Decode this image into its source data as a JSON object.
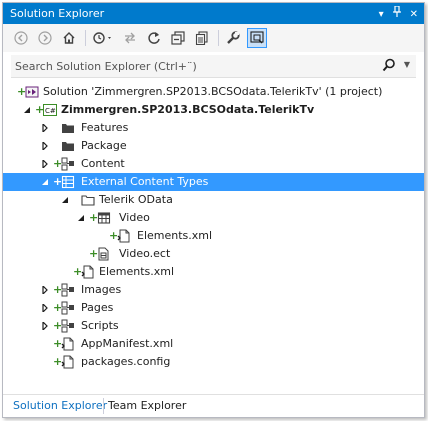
{
  "window": {
    "title": "Solution Explorer",
    "title_controls": [
      "▾",
      "▪",
      "✕"
    ]
  },
  "toolbar": {
    "buttons": [
      "back-icon",
      "forward-icon",
      "home-icon",
      "history-icon",
      "sync-icon",
      "refresh-icon",
      "collapse-all-icon",
      "show-all-files-icon",
      "properties-icon",
      "preview-icon"
    ]
  },
  "search": {
    "placeholder": "Search Solution Explorer (Ctrl+¨)"
  },
  "tree": {
    "solution": "Solution 'Zimmergren.SP2013.BCSOdata.TelerikTv' (1 project)",
    "project": "Zimmergren.SP2013.BCSOdata.TelerikTv",
    "features": "Features",
    "package": "Package",
    "content": "Content",
    "external_content_types": "External Content Types",
    "telerik_odata": "Telerik OData",
    "video": "Video",
    "video_elements": "Elements.xml",
    "video_ect": "Video.ect",
    "ect_elements": "Elements.xml",
    "images": "Images",
    "pages": "Pages",
    "scripts": "Scripts",
    "app_manifest": "AppManifest.xml",
    "packages_config": "packages.config"
  },
  "tabs": {
    "solution_explorer": "Solution Explorer",
    "team_explorer": "Team Explorer"
  },
  "colors": {
    "accent": "#007acc",
    "selection": "#3399ff",
    "plus_green": "#3c8d27"
  }
}
